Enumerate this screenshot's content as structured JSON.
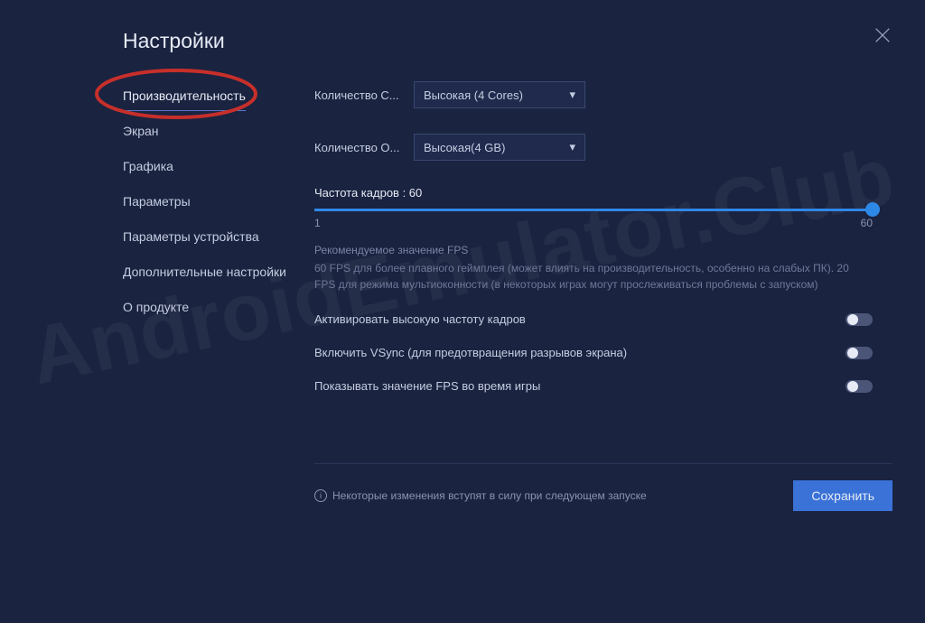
{
  "watermark": "AndroidEmulator.Club",
  "title": "Настройки",
  "sidebar": {
    "items": [
      {
        "label": "Производительность",
        "active": true
      },
      {
        "label": "Экран",
        "active": false
      },
      {
        "label": "Графика",
        "active": false
      },
      {
        "label": "Параметры",
        "active": false
      },
      {
        "label": "Параметры устройства",
        "active": false
      },
      {
        "label": "Дополнительные настройки",
        "active": false
      },
      {
        "label": "О продукте",
        "active": false
      }
    ]
  },
  "form": {
    "cores": {
      "label": "Количество C...",
      "value": "Высокая (4 Cores)"
    },
    "ram": {
      "label": "Количество О...",
      "value": "Высокая(4 GB)"
    }
  },
  "slider": {
    "label_prefix": "Частота кадров : ",
    "value": 60,
    "min": 1,
    "max": 60
  },
  "hint": {
    "title": "Рекомендуемое значение FPS",
    "body": "60 FPS для более плавного геймплея (может влиять на производительность, особенно на слабых ПК). 20 FPS для режима мультиоконности (в некоторых играх могут прослеживаться проблемы с запуском)"
  },
  "toggles": [
    {
      "label": "Активировать высокую частоту кадров",
      "on": false
    },
    {
      "label": "Включить VSync (для предотвращения разрывов экрана)",
      "on": false
    },
    {
      "label": "Показывать значение FPS во время игры",
      "on": false
    }
  ],
  "footer": {
    "restart_note": "Некоторые изменения вступят в силу при следующем запуске",
    "save": "Сохранить"
  }
}
